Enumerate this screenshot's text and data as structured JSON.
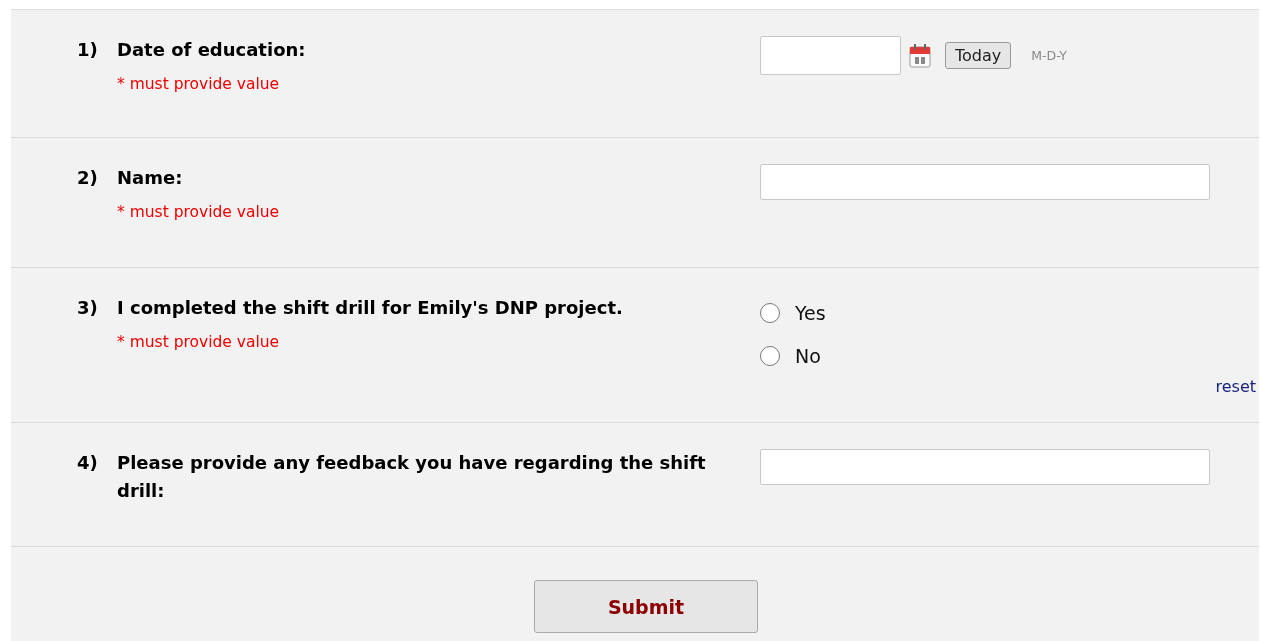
{
  "questions": [
    {
      "kind": "date",
      "number": "1)",
      "label": "Date of education:",
      "required_note": "* must provide value",
      "today_button": "Today",
      "format_hint": "M-D-Y"
    },
    {
      "kind": "text",
      "number": "2)",
      "label": "Name:",
      "required_note": "* must provide value"
    },
    {
      "kind": "radio",
      "number": "3)",
      "label": "I completed the shift drill for Emily's DNP project.",
      "required_note": "* must provide value",
      "options": [
        {
          "label": "Yes",
          "selected": false
        },
        {
          "label": "No",
          "selected": false
        }
      ],
      "reset": "reset"
    },
    {
      "kind": "text",
      "number": "4)",
      "label": "Please provide any feedback you have regarding the shift drill:"
    }
  ],
  "submit_button": "Submit"
}
